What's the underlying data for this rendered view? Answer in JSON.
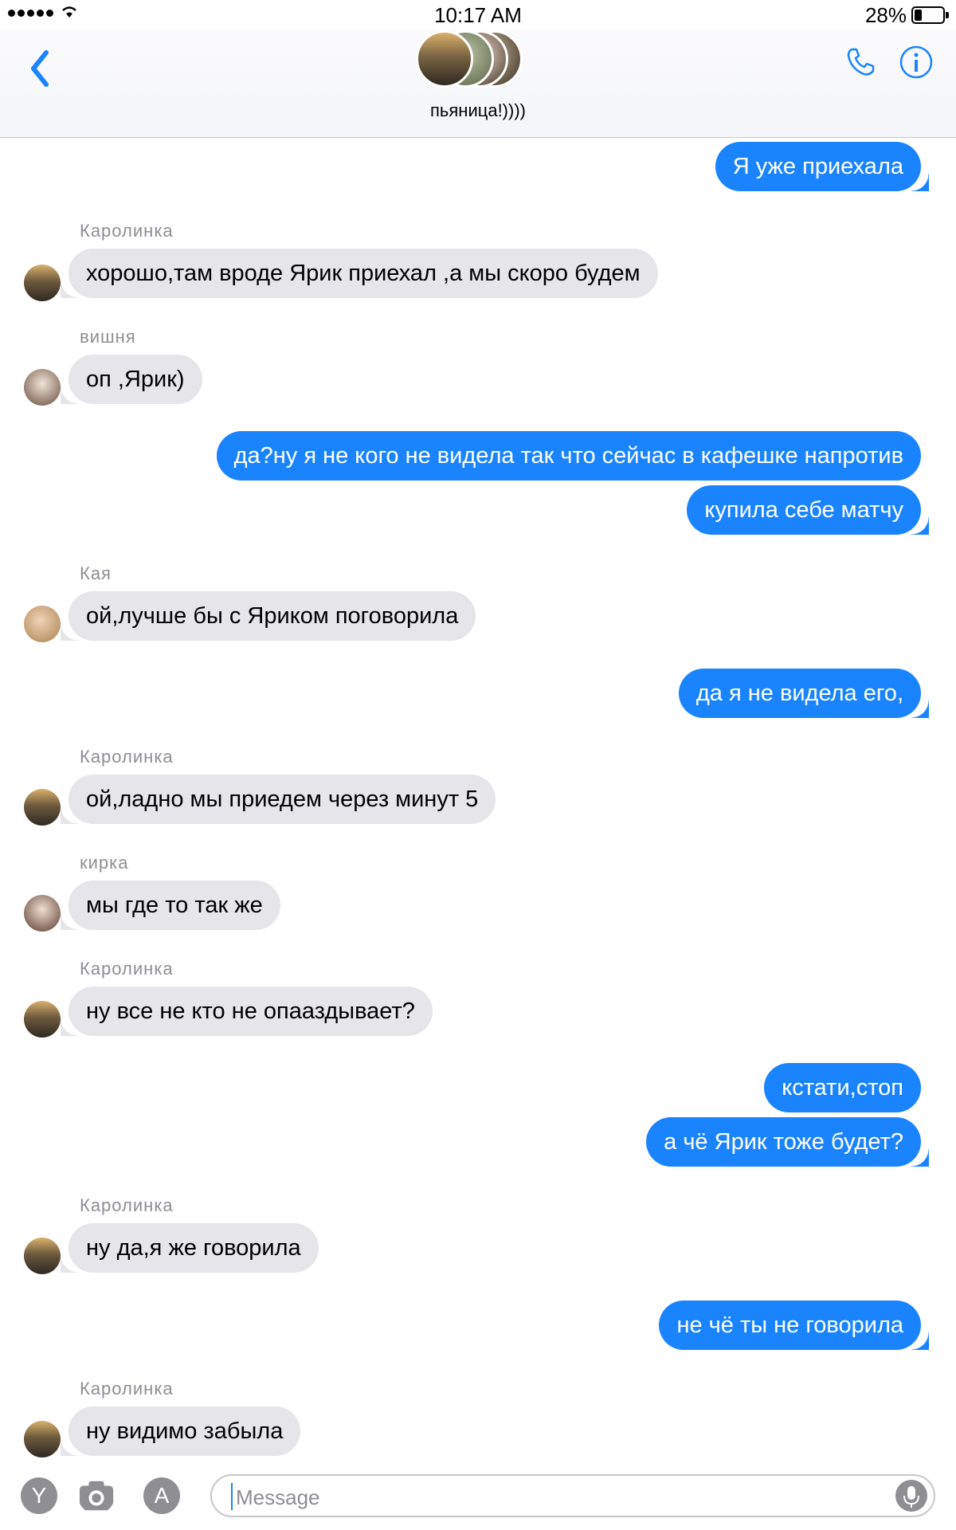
{
  "status_bar": {
    "time": "10:17 AM",
    "battery": "28%",
    "battery_level": 0.28
  },
  "header": {
    "group_name": "пьяница!))))"
  },
  "messages": [
    {
      "dir": "out",
      "text": "Я уже приехала"
    },
    {
      "dir": "in",
      "sender": "Каролинка",
      "text": "хорошо,там вроде Ярик приехал ,а мы скоро будем"
    },
    {
      "dir": "in",
      "sender": "вишня",
      "text": "оп ,Ярик)"
    },
    {
      "dir": "out",
      "text": "да?ну я не кого не видела так что сейчас в кафешке напротив"
    },
    {
      "dir": "out",
      "text": "купила себе матчу"
    },
    {
      "dir": "in",
      "sender": "Кая",
      "text": "ой,лучше бы с Яриком поговорила"
    },
    {
      "dir": "out",
      "text": "да я не видела его,"
    },
    {
      "dir": "in",
      "sender": "Каролинка",
      "text": "ой,ладно мы приедем через минут 5"
    },
    {
      "dir": "in",
      "sender": "кирка",
      "text": "мы где то так же"
    },
    {
      "dir": "in",
      "sender": "Каролинка",
      "text": "ну все не кто не опааздывает?"
    },
    {
      "dir": "out",
      "text": "кстати,стоп"
    },
    {
      "dir": "out",
      "text": "а чё Ярик тоже будет?"
    },
    {
      "dir": "in",
      "sender": "Каролинка",
      "text": "ну да,я же говорила"
    },
    {
      "dir": "out",
      "text": "не чё ты не говорила"
    },
    {
      "dir": "in",
      "sender": "Каролинка",
      "text": "ну видимо забыла"
    }
  ],
  "input": {
    "placeholder": "Message"
  },
  "icons": {
    "back": "chevron-left-icon",
    "call": "phone-icon",
    "info": "info-icon",
    "app1": "y-app-icon",
    "camera": "camera-icon",
    "appstore": "app-store-icon",
    "mic": "microphone-icon"
  },
  "colors": {
    "accent": "#1a84ff",
    "incoming": "#e5e5ea",
    "meta": "#8e8e93"
  }
}
